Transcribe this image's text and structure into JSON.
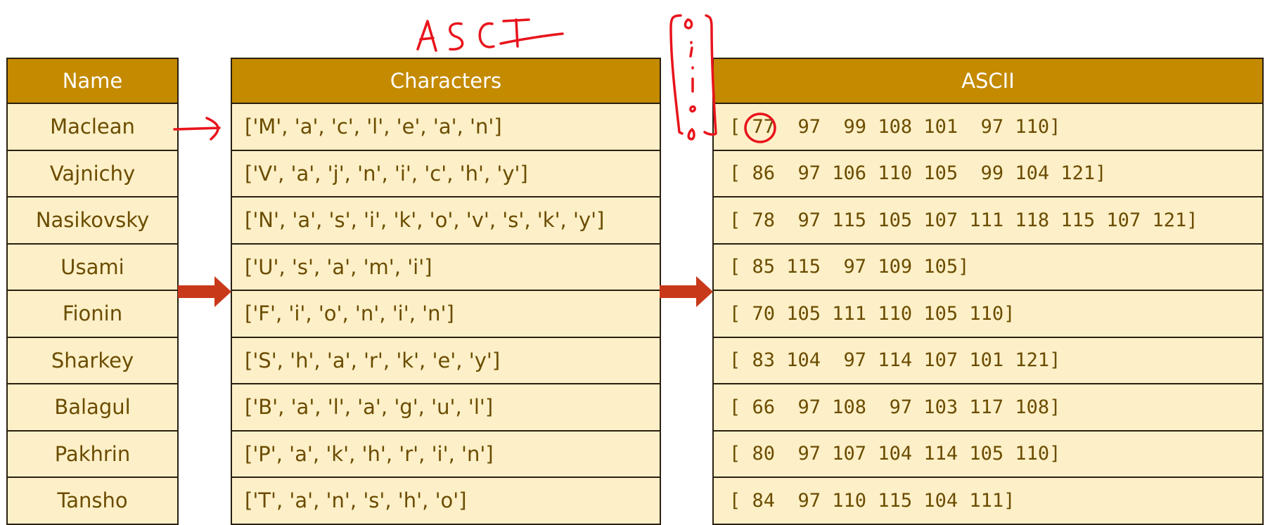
{
  "annotation": {
    "handwritten_title": "ASCII",
    "ink_color": "#e8141c"
  },
  "colors": {
    "header": "#c48a00",
    "cell": "#fdf0c8",
    "text": "#6b4c00",
    "arrow": "#c8391a"
  },
  "columns": {
    "name": "Name",
    "characters": "Characters",
    "ascii": "ASCII"
  },
  "rows": [
    {
      "name": "Maclean",
      "characters": "['M', 'a', 'c', 'l', 'e', 'a', 'n']",
      "ascii": "[ 77  97  99 108 101  97 110]"
    },
    {
      "name": "Vajnichy",
      "characters": "['V', 'a', 'j', 'n', 'i', 'c', 'h', 'y']",
      "ascii": "[ 86  97 106 110 105  99 104 121]"
    },
    {
      "name": "Nasikovsky",
      "characters": "['N', 'a', 's', 'i', 'k', 'o', 'v', 's', 'k', 'y']",
      "ascii": "[ 78  97 115 105 107 111 118 115 107 121]"
    },
    {
      "name": "Usami",
      "characters": "['U', 's', 'a', 'm', 'i']",
      "ascii": "[ 85 115  97 109 105]"
    },
    {
      "name": "Fionin",
      "characters": "['F', 'i', 'o', 'n', 'i', 'n']",
      "ascii": "[ 70 105 111 110 105 110]"
    },
    {
      "name": "Sharkey",
      "characters": "['S', 'h', 'a', 'r', 'k', 'e', 'y']",
      "ascii": "[ 83 104  97 114 107 101 121]"
    },
    {
      "name": "Balagul",
      "characters": "['B', 'a', 'l', 'a', 'g', 'u', 'l']",
      "ascii": "[ 66  97 108  97 103 117 108]"
    },
    {
      "name": "Pakhrin",
      "characters": "['P', 'a', 'k', 'h', 'r', 'i', 'n']",
      "ascii": "[ 80  97 107 104 114 105 110]"
    },
    {
      "name": "Tansho",
      "characters": "['T', 'a', 'n', 's', 'h', 'o']",
      "ascii": "[ 84  97 110 115 104 111]"
    }
  ]
}
